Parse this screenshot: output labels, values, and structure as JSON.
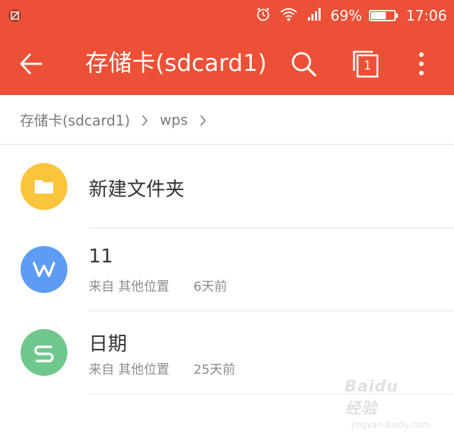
{
  "status_bar": {
    "battery_percent_label": "69%",
    "battery_level": 0.69,
    "time": "17:06",
    "icons": [
      "screenshot-icon",
      "alarm-icon",
      "wifi-icon",
      "signal-icon",
      "battery-icon"
    ]
  },
  "toolbar": {
    "title": "存储卡(sdcard1)",
    "tab_count": "1",
    "icons": [
      "back-arrow-icon",
      "search-icon",
      "tabs-icon",
      "more-icon"
    ],
    "color": "#ec5036"
  },
  "breadcrumb": {
    "items": [
      "存储卡(sdcard1)",
      "wps"
    ]
  },
  "files": [
    {
      "name": "新建文件夹",
      "icon": "folder-icon",
      "color": "#fcc43a"
    },
    {
      "name": "11",
      "source": "来自 其他位置",
      "date": "6天前",
      "icon": "wps-writer-icon",
      "color": "#5c9cf5"
    },
    {
      "name": "日期",
      "source": "来自 其他位置",
      "date": "25天前",
      "icon": "wps-spreadsheet-icon",
      "color": "#6ec88b"
    }
  ],
  "watermark": {
    "brand": "Baidu经验",
    "url": "jingyan.baidu.com"
  }
}
